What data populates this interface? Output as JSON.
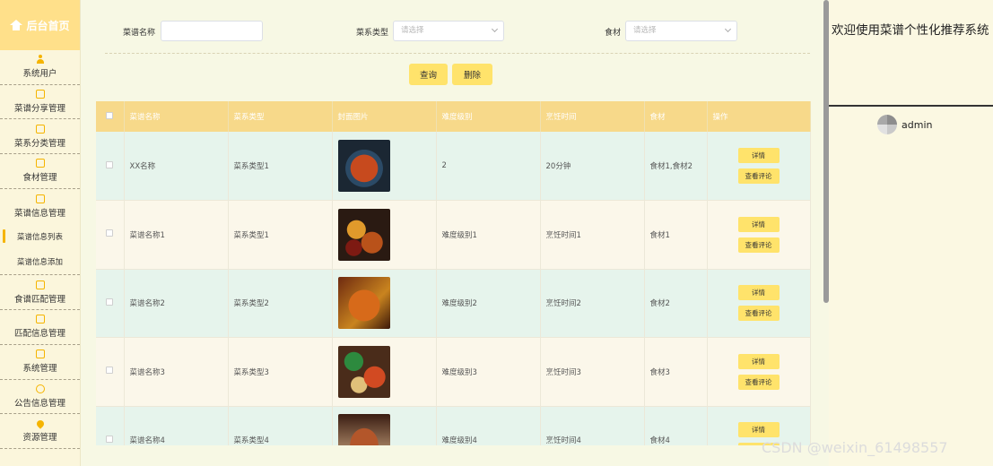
{
  "sidebar": {
    "title": "后台首页",
    "items": [
      {
        "label": "系统用户",
        "icon": "user-icon"
      },
      {
        "label": "菜谱分享管理",
        "icon": "edit-icon"
      },
      {
        "label": "菜系分类管理",
        "icon": "edit-icon"
      },
      {
        "label": "食材管理",
        "icon": "edit-icon"
      },
      {
        "label": "菜谱信息管理",
        "icon": "edit-icon"
      }
    ],
    "subitems": [
      {
        "label": "菜谱信息列表",
        "active": true
      },
      {
        "label": "菜谱信息添加",
        "active": false
      }
    ],
    "items_after": [
      {
        "label": "食谱匹配管理",
        "icon": "edit-icon"
      },
      {
        "label": "匹配信息管理",
        "icon": "edit-icon"
      },
      {
        "label": "系统管理",
        "icon": "edit-icon"
      },
      {
        "label": "公告信息管理",
        "icon": "clock-icon"
      },
      {
        "label": "资源管理",
        "icon": "pin-icon"
      }
    ]
  },
  "filters": {
    "name_label": "菜谱名称",
    "name_value": "",
    "type_label": "菜系类型",
    "type_placeholder": "请选择",
    "ingredient_label": "食材",
    "ingredient_placeholder": "请选择"
  },
  "actions": {
    "query": "查询",
    "delete": "删除"
  },
  "table": {
    "headers": [
      "菜谱名称",
      "菜系类型",
      "封面图片",
      "难度级别",
      "烹饪时间",
      "食材",
      "操作"
    ],
    "detail_label": "详情",
    "review_label": "查看评论",
    "rows": [
      {
        "name": "XX名称",
        "type": "菜系类型1",
        "difficulty": "2",
        "time": "20分钟",
        "ingredient": "食材1,食材2"
      },
      {
        "name": "菜谱名称1",
        "type": "菜系类型1",
        "difficulty": "难度级别1",
        "time": "烹饪时间1",
        "ingredient": "食材1"
      },
      {
        "name": "菜谱名称2",
        "type": "菜系类型2",
        "difficulty": "难度级别2",
        "time": "烹饪时间2",
        "ingredient": "食材2"
      },
      {
        "name": "菜谱名称3",
        "type": "菜系类型3",
        "difficulty": "难度级别3",
        "time": "烹饪时间3",
        "ingredient": "食材3"
      },
      {
        "name": "菜谱名称4",
        "type": "菜系类型4",
        "difficulty": "难度级别4",
        "time": "烹饪时间4",
        "ingredient": "食材4"
      }
    ]
  },
  "header": {
    "welcome": "欢迎使用菜谱个性化推荐系统",
    "username": "admin"
  },
  "watermark": "CSDN @weixin_61498557",
  "colors": {
    "accent": "#ffe36b",
    "header": "#f7d98a",
    "row_green": "#e6f4ec",
    "row_cream": "#fbf7ea"
  }
}
